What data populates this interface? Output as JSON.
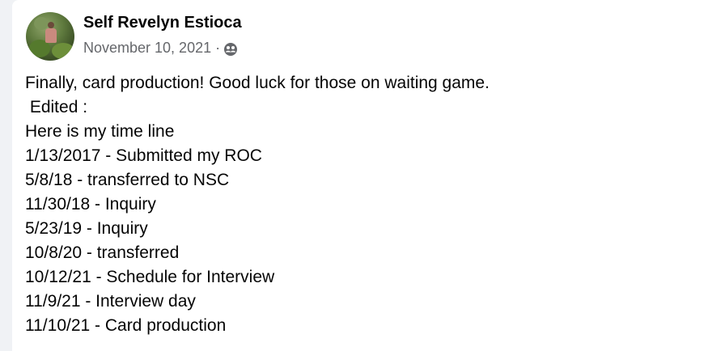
{
  "post": {
    "author": "Self Revelyn Estioca",
    "date": "November 10, 2021",
    "separator": "·",
    "audience_icon": "friends-icon",
    "lines": [
      "Finally, card production! Good luck for those on waiting game.",
      " Edited :",
      "Here is my time line",
      "1/13/2017 - Submitted my ROC",
      "5/8/18 - transferred to NSC",
      "11/30/18 - Inquiry",
      "5/23/19 - Inquiry",
      "10/8/20 - transferred",
      "10/12/21 - Schedule for Interview",
      "11/9/21 - Interview day",
      "11/10/21 - Card production"
    ]
  }
}
